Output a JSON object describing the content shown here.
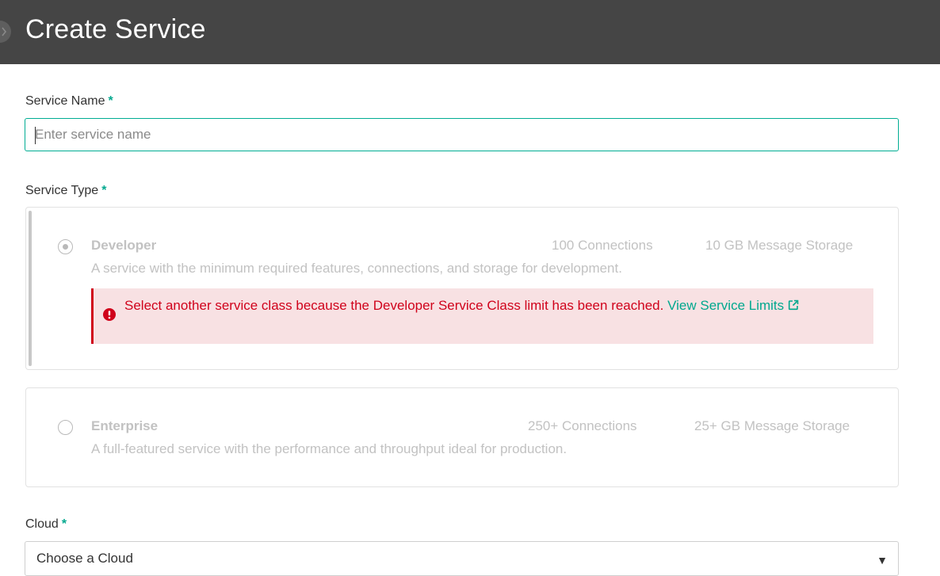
{
  "header": {
    "title": "Create Service"
  },
  "service_name": {
    "label": "Service Name",
    "required_mark": "*",
    "placeholder": "Enter service name",
    "value": ""
  },
  "service_type": {
    "label": "Service Type",
    "required_mark": "*",
    "options": [
      {
        "name": "Developer",
        "connections": "100 Connections",
        "storage": "10 GB Message Storage",
        "description": "A service with the minimum required features, connections, and storage for development.",
        "selected": true,
        "alert": {
          "message": "Select another service class because the Developer Service Class limit has been reached.",
          "link_text": "View Service Limits",
          "icon": "exclamation-circle-icon",
          "link_icon": "external-link-icon"
        }
      },
      {
        "name": "Enterprise",
        "connections": "250+ Connections",
        "storage": "25+ GB Message Storage",
        "description": "A full-featured service with the performance and throughput ideal for production.",
        "selected": false
      }
    ]
  },
  "cloud": {
    "label": "Cloud",
    "required_mark": "*",
    "selected_value": "Choose a Cloud"
  },
  "colors": {
    "header_bg": "#454545",
    "accent": "#00a88e",
    "error": "#d0021b",
    "error_bg": "#f8e1e3"
  }
}
